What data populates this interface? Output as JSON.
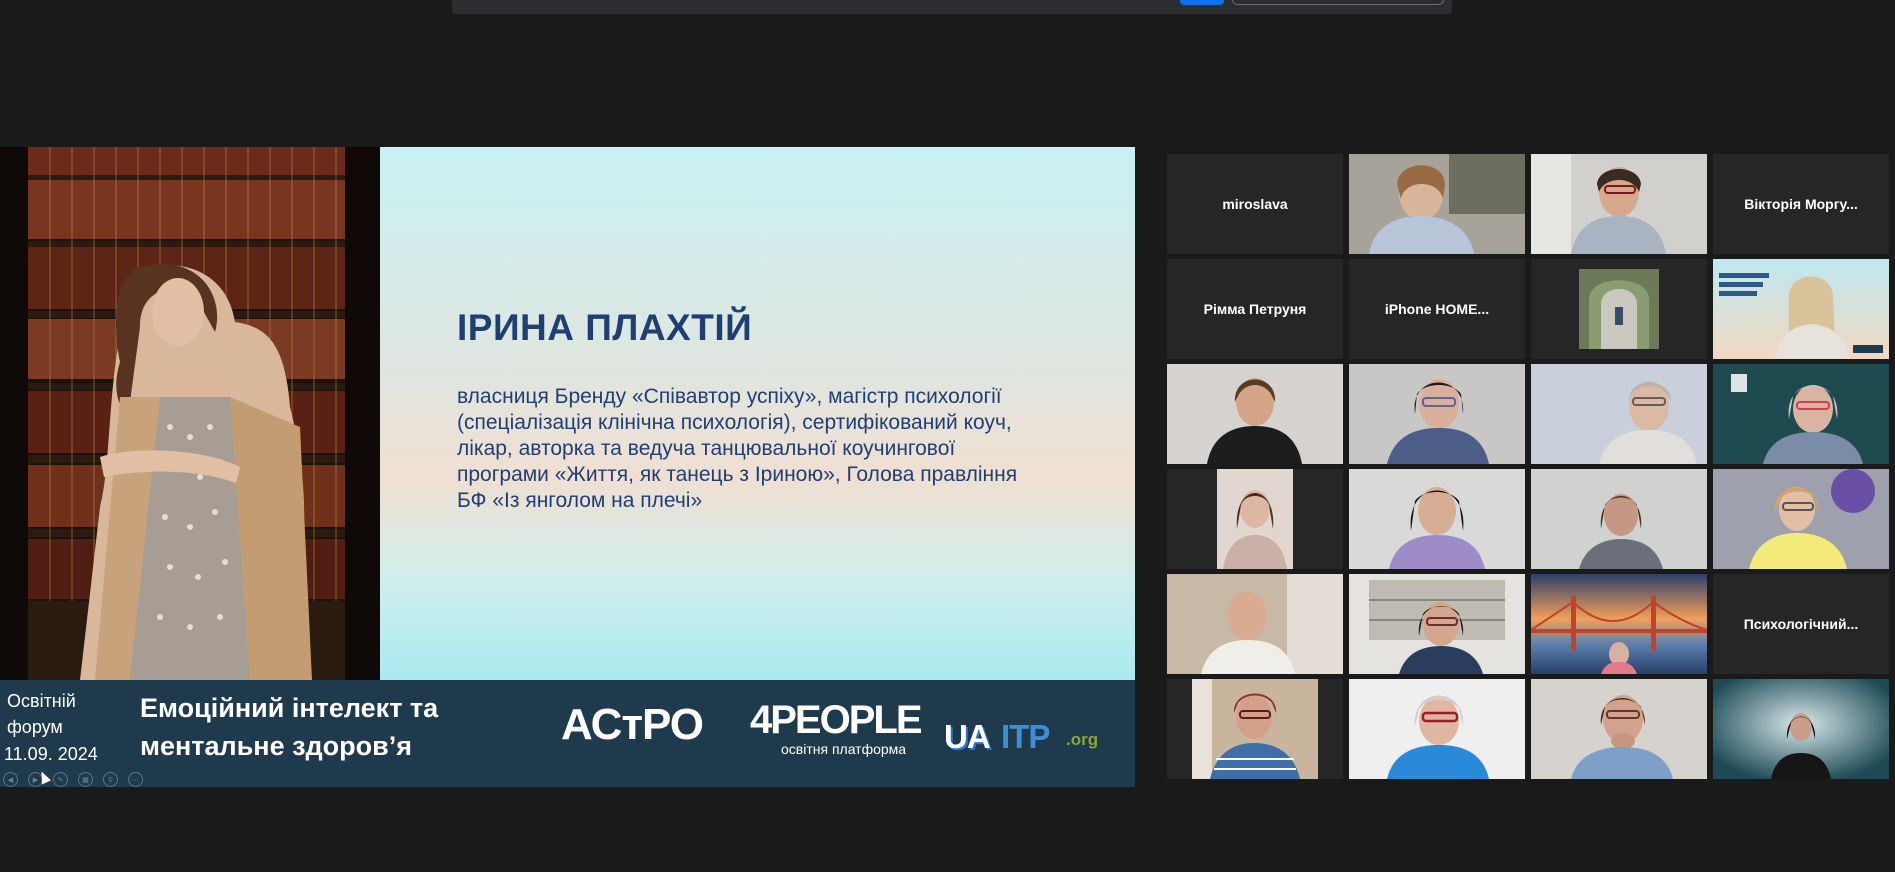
{
  "slide": {
    "title": "ІРИНА ПЛАХТІЙ",
    "description": "власниця Бренду «Співавтор успіху», магістр психології (спеціалізація клінічна психологія), сертифікований коуч, лікар, авторка та ведуча танцювальної коучингової програми «Життя, як танець з Іриною», Голова правління БФ «Із янголом на плечі»",
    "banner": {
      "forum_label": "Освітній форум",
      "date": "11.09. 2024",
      "title": "Емоційний інтелект та ментальне здоров’я",
      "logo_astro": "АСтРО",
      "logo_4people_main": "4PEOPLE",
      "logo_4people_sub": "освітня платформа",
      "logo_ua": "UA",
      "logo_itp": "ITP",
      "logo_org": ".org"
    }
  },
  "gallery": {
    "participants": [
      {
        "name": "miroslava",
        "video": false
      },
      {
        "name": "",
        "video": true
      },
      {
        "name": "",
        "video": true
      },
      {
        "name": "Вікторія Моргу...",
        "video": false
      },
      {
        "name": "Рімма Петруня",
        "video": false
      },
      {
        "name": "iPhone HOME...",
        "video": false
      },
      {
        "name": "",
        "video": true
      },
      {
        "name": "",
        "video": true,
        "active_speaker": true
      },
      {
        "name": "",
        "video": true
      },
      {
        "name": "",
        "video": true
      },
      {
        "name": "",
        "video": true
      },
      {
        "name": "",
        "video": true
      },
      {
        "name": "",
        "video": true
      },
      {
        "name": "",
        "video": true
      },
      {
        "name": "",
        "video": true
      },
      {
        "name": "",
        "video": true
      },
      {
        "name": "",
        "video": true
      },
      {
        "name": "",
        "video": true
      },
      {
        "name": "",
        "video": true
      },
      {
        "name": "Психологічний...",
        "video": false
      },
      {
        "name": "",
        "video": true
      },
      {
        "name": "",
        "video": true
      },
      {
        "name": "",
        "video": true
      },
      {
        "name": "",
        "video": true
      }
    ]
  },
  "colors": {
    "active_speaker_border": "#e5e36b",
    "slide_text": "#1f3f73",
    "banner_bg": "#1f3a4c",
    "toolbar_accent": "#0e72ed"
  }
}
